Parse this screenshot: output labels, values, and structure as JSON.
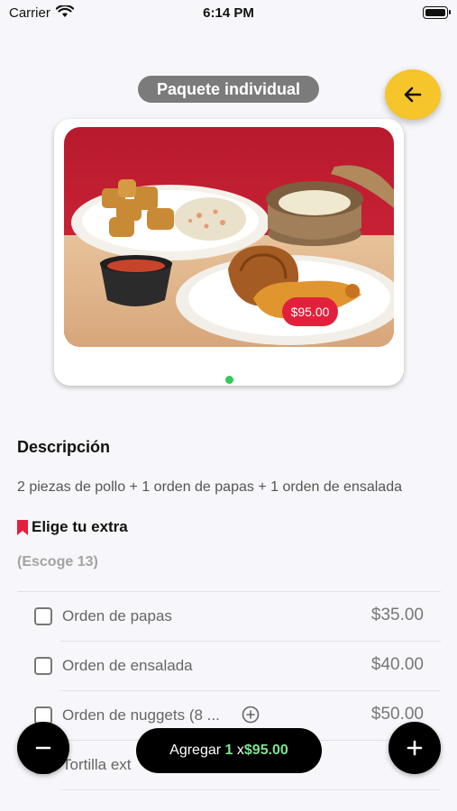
{
  "status_bar": {
    "carrier": "Carrier",
    "time": "6:14 PM"
  },
  "header": {
    "title": "Paquete individual",
    "back_icon": "arrow-left-icon",
    "back_color": "#f6c42b"
  },
  "product": {
    "price": "$95.00",
    "price_color": "#e3203b",
    "page_indicator_color": "#34c759"
  },
  "description": {
    "title": "Descripción",
    "text": "2 piezas de pollo + 1 orden de papas + 1 orden de ensalada"
  },
  "extras": {
    "title": "Elige tu extra",
    "note": "(Escoge 13)",
    "options": [
      {
        "name": "Orden de papas",
        "price": "$35.00",
        "checked": false
      },
      {
        "name": "Orden de ensalada",
        "price": "$40.00",
        "checked": false
      },
      {
        "name": "Orden de nuggets (8 ...",
        "price": "$50.00",
        "checked": false,
        "info_icon": "plus-circle-icon"
      },
      {
        "name": "Tortilla ext",
        "price": "$",
        "checked": false
      }
    ]
  },
  "footer": {
    "add_label": "Agregar",
    "quantity": "1",
    "times": "x",
    "total": "$95.00",
    "minus_icon": "minus-icon",
    "plus_icon": "plus-icon"
  }
}
